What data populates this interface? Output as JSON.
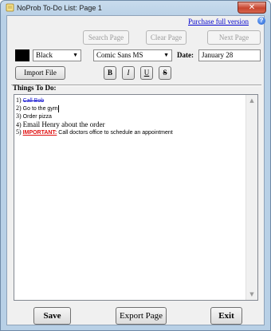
{
  "window": {
    "title": "NoProb To-Do List: Page 1",
    "close_label": "✕"
  },
  "header": {
    "purchase_link": "Purchase full version",
    "help_glyph": "?"
  },
  "toolbar": {
    "search_page": "Search Page",
    "clear_page": "Clear Page",
    "next_page": "Next Page",
    "color_value": "Black",
    "color_swatch": "#000000",
    "font_value": "Comic Sans MS",
    "date_label": "Date:",
    "date_value": "January 28",
    "import_file": "Import File",
    "bold": "B",
    "italic": "I",
    "underline": "U",
    "strike": "S"
  },
  "list": {
    "heading": "Things To Do:",
    "items": [
      {
        "num": "1)",
        "text": "Call Bob"
      },
      {
        "num": "2)",
        "text": "Go to the gym"
      },
      {
        "num": "3)",
        "text": "Order pizza"
      },
      {
        "num": "4)",
        "text": "Email Henry about the order"
      },
      {
        "num": "5)",
        "tag": "IMPORTANT:",
        "text": " Call doctors office to schedule an appointment"
      }
    ]
  },
  "footer": {
    "save": "Save",
    "export_page": "Export Page",
    "exit": "Exit"
  },
  "icons": {
    "app": "notepad-icon",
    "help": "help-icon",
    "dropdown": "chevron-down-icon"
  },
  "colors": {
    "link": "#0000cc",
    "strike_text": "#1a1ad1",
    "important": "#e01010"
  }
}
